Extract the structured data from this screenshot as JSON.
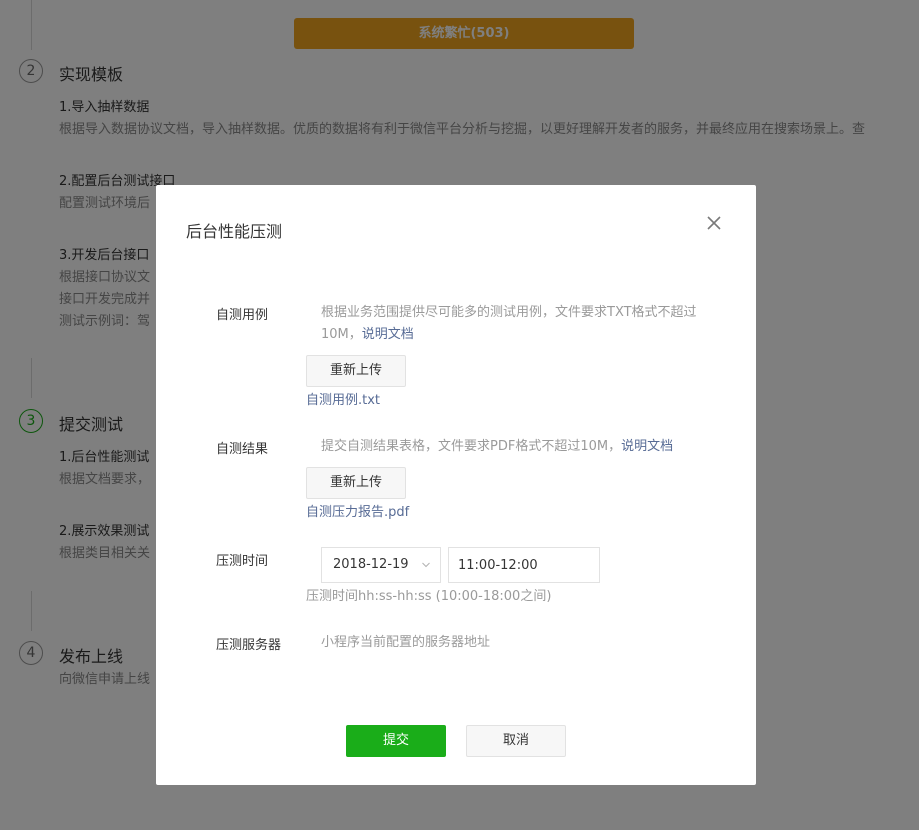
{
  "background": {
    "banner": "系统繁忙(503)",
    "steps": [
      {
        "number": "2",
        "title": "实现模板",
        "items": [
          {
            "title": "1.导入抽样数据",
            "desc": "根据导入数据协议文档，导入抽样数据。优质的数据将有利于微信平台分析与挖掘，以更好理解开发者的服务，并最终应用在搜索场景上。查"
          },
          {
            "title": "2.配置后台测试接口",
            "desc": "配置测试环境后"
          },
          {
            "title": "3.开发后台接口",
            "desc": "根据接口协议文",
            "desc2": "接口开发完成并",
            "desc3": "测试示例词：驾"
          }
        ]
      },
      {
        "number": "3",
        "title": "提交测试",
        "items": [
          {
            "title": "1.后台性能测试",
            "desc": "根据文档要求，"
          },
          {
            "title": "2.展示效果测试",
            "desc": "根据类目相关关"
          }
        ]
      },
      {
        "number": "4",
        "title": "发布上线",
        "items": [
          {
            "desc": "向微信申请上线"
          }
        ]
      }
    ]
  },
  "dialog": {
    "title": "后台性能压测",
    "close_icon": "close-icon",
    "self_test_cases": {
      "label": "自测用例",
      "tip": "根据业务范围提供尽可能多的测试用例，文件要求TXT格式不超过10M，",
      "doc_link": "说明文档",
      "upload_button": "重新上传",
      "file_name": "自测用例.txt"
    },
    "self_test_results": {
      "label": "自测结果",
      "tip": "提交自测结果表格，文件要求PDF格式不超过10M，",
      "doc_link": "说明文档",
      "upload_button": "重新上传",
      "file_name": "自测压力报告.pdf"
    },
    "stress_time": {
      "label": "压测时间",
      "date_value": "2018-12-19",
      "time_value": "11:00-12:00",
      "hint": "压测时间hh:ss-hh:ss (10:00-18:00之间)"
    },
    "stress_server": {
      "label": "压测服务器",
      "tip": "小程序当前配置的服务器地址"
    },
    "submit_button": "提交",
    "cancel_button": "取消"
  },
  "colors": {
    "banner": "#f0a51e",
    "primary": "#1aad19",
    "link": "#576b95",
    "overlay": "rgba(0,0,0,0.5)"
  }
}
